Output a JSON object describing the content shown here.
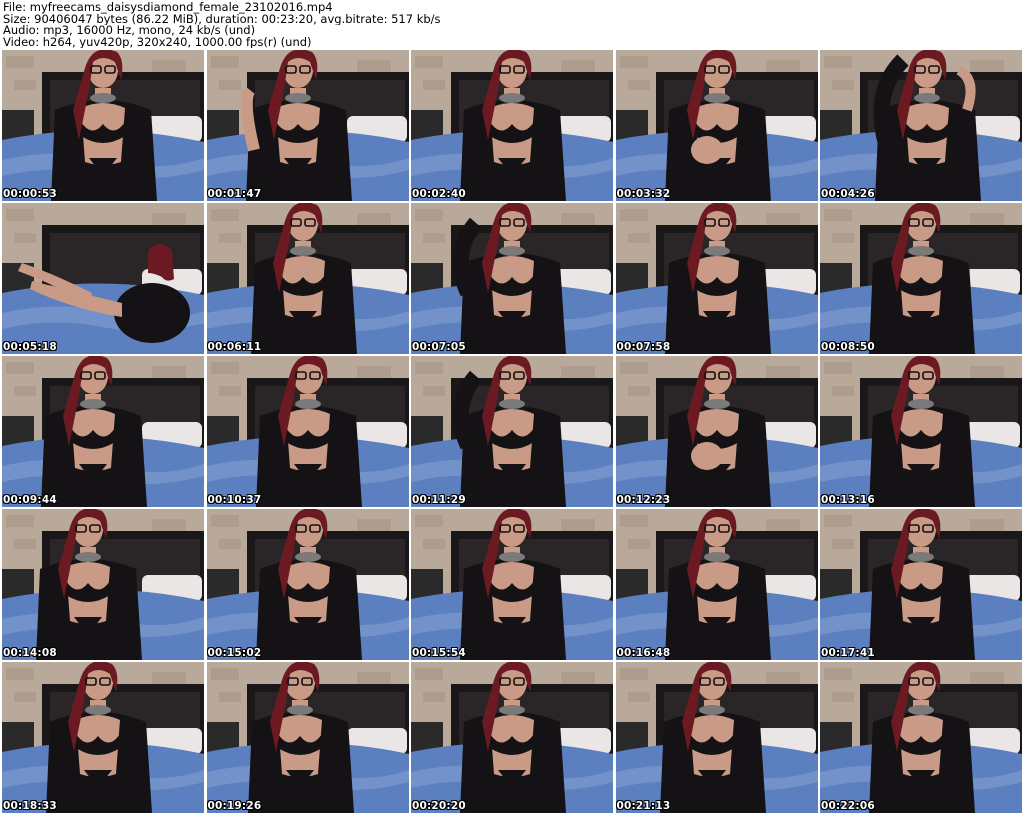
{
  "header": {
    "file_line": "File: myfreecams_daisysdiamond_female_23102016.mp4",
    "size_line": "Size: 90406047 bytes (86.22 MiB), duration: 00:23:20, avg.bitrate: 517 kb/s",
    "audio_line": "Audio: mp3, 16000 Hz, mono, 24 kb/s (und)",
    "video_line": "Video: h264, yuv420p, 320x240, 1000.00 fps(r) (und)"
  },
  "thumbnails": [
    {
      "timestamp": "00:00:53"
    },
    {
      "timestamp": "00:01:47"
    },
    {
      "timestamp": "00:02:40"
    },
    {
      "timestamp": "00:03:32"
    },
    {
      "timestamp": "00:04:26"
    },
    {
      "timestamp": "00:05:18"
    },
    {
      "timestamp": "00:06:11"
    },
    {
      "timestamp": "00:07:05"
    },
    {
      "timestamp": "00:07:58"
    },
    {
      "timestamp": "00:08:50"
    },
    {
      "timestamp": "00:09:44"
    },
    {
      "timestamp": "00:10:37"
    },
    {
      "timestamp": "00:11:29"
    },
    {
      "timestamp": "00:12:23"
    },
    {
      "timestamp": "00:13:16"
    },
    {
      "timestamp": "00:14:08"
    },
    {
      "timestamp": "00:15:02"
    },
    {
      "timestamp": "00:15:54"
    },
    {
      "timestamp": "00:16:48"
    },
    {
      "timestamp": "00:17:41"
    },
    {
      "timestamp": "00:18:33"
    },
    {
      "timestamp": "00:19:26"
    },
    {
      "timestamp": "00:20:20"
    },
    {
      "timestamp": "00:21:13"
    },
    {
      "timestamp": "00:22:06"
    }
  ],
  "colors": {
    "wall": "#b9a99a",
    "wall_stone": "#a39282",
    "headboard": "#1a1718",
    "bedding": "#5c7fbf",
    "bedding_light": "#8aa6d6",
    "pillow": "#e9e6e5",
    "hair": "#6b1a22",
    "skin": "#c99a86",
    "clothing": "#141214",
    "timestamp_text": "#ffffff"
  }
}
